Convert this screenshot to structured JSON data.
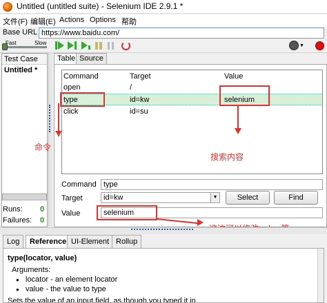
{
  "window": {
    "title": "Untitled (untitled suite) - Selenium IDE 2.9.1 *"
  },
  "menu": [
    "文件(F)",
    "编辑(E)",
    "Actions",
    "Options",
    "帮助"
  ],
  "base_url": {
    "label": "Base URL",
    "value": "https://www.baidu.com/"
  },
  "speed": {
    "fast_label": "Fast",
    "slow_label": "Slow"
  },
  "testcase": {
    "header": "Test Case",
    "item": "Untitled *"
  },
  "stats": {
    "runs_label": "Runs:",
    "runs_value": "0",
    "failures_label": "Failures:",
    "failures_value": "0"
  },
  "tabs": [
    "Table",
    "Source"
  ],
  "table": {
    "headers": [
      "Command",
      "Target",
      "Value"
    ],
    "rows": [
      {
        "command": "open",
        "target": "/",
        "value": ""
      },
      {
        "command": "type",
        "target": "id=kw",
        "value": "selenium",
        "selected": true
      },
      {
        "command": "click",
        "target": "id=su",
        "value": ""
      }
    ]
  },
  "editor": {
    "command_label": "Command",
    "command_value": "type",
    "target_label": "Target",
    "target_value": "id=kw",
    "value_label": "Value",
    "value_value": "selenium",
    "select_button": "Select",
    "find_button": "Find"
  },
  "bottom_tabs": [
    "Log",
    "Reference",
    "UI-Element",
    "Rollup"
  ],
  "reference": {
    "signature": "type(locator, value)",
    "arguments_label": "Arguments:",
    "args": [
      "locator - an element locator",
      "value - the value to type"
    ],
    "desc": "Sets the value of an input field, as though you typed it in."
  },
  "annotations": {
    "command_note": "命令",
    "value_note": "搜索内容",
    "edit_note": "这边可以修改value等"
  },
  "colors": {
    "annotation": "#e03030",
    "selected_row": "#d8f0d8",
    "play": "#3aa33a"
  }
}
